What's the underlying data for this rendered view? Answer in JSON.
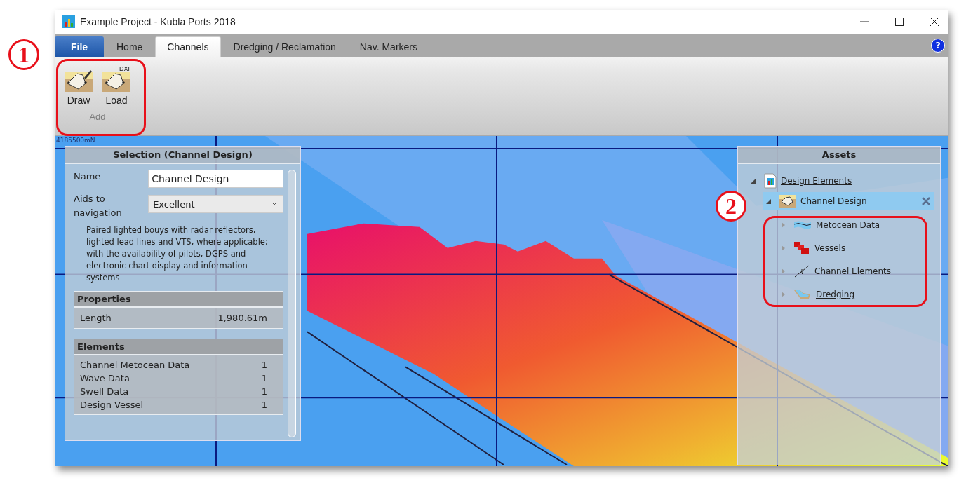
{
  "window": {
    "title": "Example Project - Kubla Ports 2018"
  },
  "tabs": [
    {
      "label": "File",
      "kind": "file",
      "selected": false
    },
    {
      "label": "Home",
      "kind": "tab",
      "selected": false
    },
    {
      "label": "Channels",
      "kind": "tab",
      "selected": true
    },
    {
      "label": "Dredging / Reclamation",
      "kind": "tab",
      "selected": false
    },
    {
      "label": "Nav. Markers",
      "kind": "tab",
      "selected": false
    }
  ],
  "help": {
    "label": "?"
  },
  "ribbon": {
    "group": "Add",
    "buttons": [
      {
        "label": "Draw",
        "kind": "draw"
      },
      {
        "label": "Load",
        "kind": "load",
        "badge": "DXF"
      }
    ]
  },
  "map": {
    "label": "4185500mN"
  },
  "selection_panel": {
    "title": "Selection (Channel Design)",
    "name_label": "Name",
    "name_value": "Channel Design",
    "aids_label": "Aids to navigation",
    "aids_value": "Excellent",
    "aids_description": "Paired lighted bouys with radar reflectors, lighted lead lines and VTS, where applicable; with the availability of pilots, DGPS and electronic chart display and information systems",
    "properties": {
      "title": "Properties",
      "rows": [
        {
          "label": "Length",
          "value": "1,980.61m"
        }
      ]
    },
    "elements": {
      "title": "Elements",
      "rows": [
        {
          "label": "Channel Metocean Data",
          "value": "1"
        },
        {
          "label": "Wave Data",
          "value": "1"
        },
        {
          "label": "Swell Data",
          "value": "1"
        },
        {
          "label": "Design Vessel",
          "value": "1"
        }
      ]
    }
  },
  "assets": {
    "title": "Assets",
    "tree": [
      {
        "label": "Design Elements",
        "kind": "document",
        "expanded": true,
        "selected": false,
        "children": [
          {
            "label": "Channel Design",
            "kind": "channel",
            "expanded": true,
            "selected": true,
            "children": [
              {
                "label": "Metocean Data",
                "kind": "waves",
                "expanded": false,
                "selected": false
              },
              {
                "label": "Vessels",
                "kind": "vessels",
                "expanded": false,
                "selected": false
              },
              {
                "label": "Channel Elements",
                "kind": "line",
                "expanded": false,
                "selected": false
              },
              {
                "label": "Dredging",
                "kind": "dredging",
                "expanded": false,
                "selected": false
              }
            ]
          }
        ]
      }
    ]
  },
  "callouts": [
    {
      "label": "1"
    },
    {
      "label": "2"
    }
  ]
}
